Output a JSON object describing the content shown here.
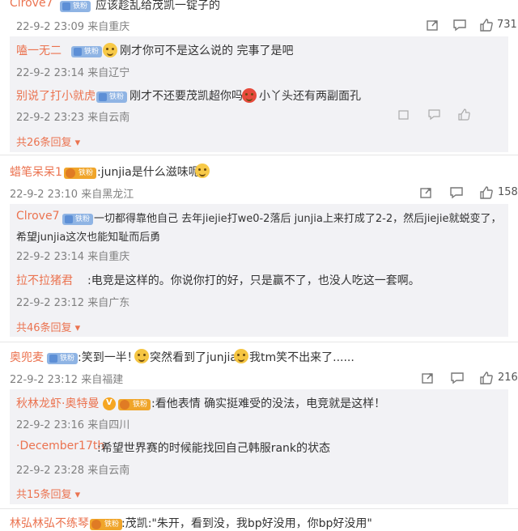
{
  "comments": [
    {
      "id": "c1",
      "user": "Clrove7",
      "text": "应该趁乱给茂凯一锭子的",
      "meta": "22-9-2 23:09 来自重庆",
      "likes": "731",
      "replies": [
        {
          "user": "嗑一无二",
          "text_before": "刚才你可不是这么说的  完事了是吧",
          "meta": "22-9-2 23:14 来自辽宁"
        },
        {
          "user": "别说了打小就虎",
          "text_before": "刚才不还要茂凯超你吗",
          "text_after": "小丫头还有两副面孔",
          "meta": "22-9-2 23:23 来自云南"
        }
      ],
      "more": "共26条回复"
    },
    {
      "id": "c2",
      "user": "蜡笔呆呆1",
      "badge": "铁粉",
      "text": ":junjia是什么滋味呢",
      "meta": "22-9-2 23:10 来自黑龙江",
      "likes": "158",
      "replies": [
        {
          "user": "Clrove7",
          "line1": "一切都得靠他自己 去年jiejie打we0-2落后 junjia上来打成了2-2，然后jiejie就蜕变了，",
          "line2": "希望junjia这次也能知耻而后勇",
          "meta": "22-9-2 23:14 来自重庆"
        },
        {
          "user": "拉不拉猪君",
          "text_before": ":电竞是这样的。你说你打的好，只是赢不了，也没人吃这一套啊。",
          "meta": "22-9-2 23:12 来自广东"
        }
      ],
      "more": "共46条回复"
    },
    {
      "id": "c3",
      "user": "奥兜麦",
      "text_a": ":笑到一半！",
      "text_b": "突然看到了junjia",
      "text_c": "我tm笑不出来了......",
      "meta": "22-9-2 23:12 来自福建",
      "likes": "216",
      "replies": [
        {
          "user": "秋林龙虾·奥特曼",
          "text_before": ":看他表情 确实挺难受的没法，电竞就是这样！",
          "meta": "22-9-2 23:16 来自四川"
        },
        {
          "user": "·December17th",
          "text_before": ":希望世界赛的时候能找回自己韩服rank的状态",
          "meta": "22-9-2 23:28 来自云南"
        }
      ],
      "more": "共15条回复"
    },
    {
      "id": "c4",
      "user": "林弘林弘不练琴",
      "text": ":茂凯:\"朱开，看到没，我bp好没用，你bp好没用\""
    }
  ],
  "badge_label": "铁粉",
  "accent": "#eb7350",
  "reply_bg": "#f2f2f5"
}
